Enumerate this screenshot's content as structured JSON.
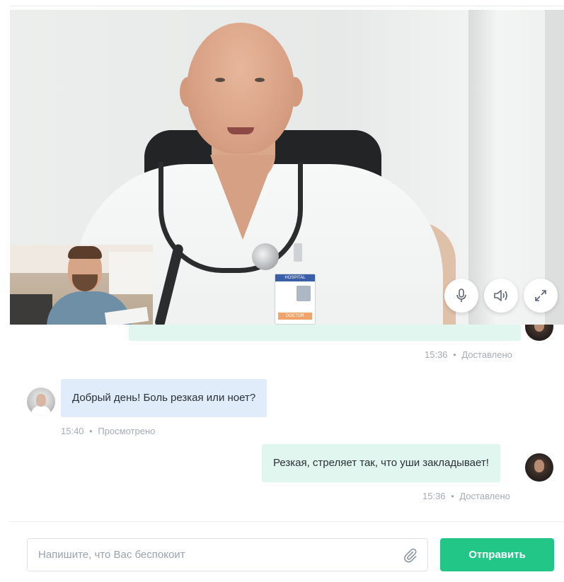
{
  "colors": {
    "accent": "#22c787",
    "outgoing_bubble": "#e1f6ee",
    "incoming_bubble": "#e1ecfb",
    "meta_text": "#a5acb6"
  },
  "video_call": {
    "controls": {
      "mic_icon": "microphone-icon",
      "sound_icon": "speaker-icon",
      "fullscreen_icon": "expand-icon"
    },
    "badge": {
      "header": "HOSPITAL",
      "role": "DOCTOR"
    }
  },
  "messages": [
    {
      "direction": "out",
      "text": "",
      "time": "15:36",
      "status": "Доставлено"
    },
    {
      "direction": "in",
      "text": "Добрый день! Боль резкая или ноет?",
      "time": "15:40",
      "status": "Просмотрено"
    },
    {
      "direction": "out",
      "text": "Резкая, стреляет так, что уши закладывает!",
      "time": "15:36",
      "status": "Доставлено"
    }
  ],
  "composer": {
    "placeholder": "Напишите, что Вас беспокоит",
    "value": "",
    "attach_icon": "paperclip-icon",
    "send_label": "Отправить"
  },
  "meta_separator": "•"
}
